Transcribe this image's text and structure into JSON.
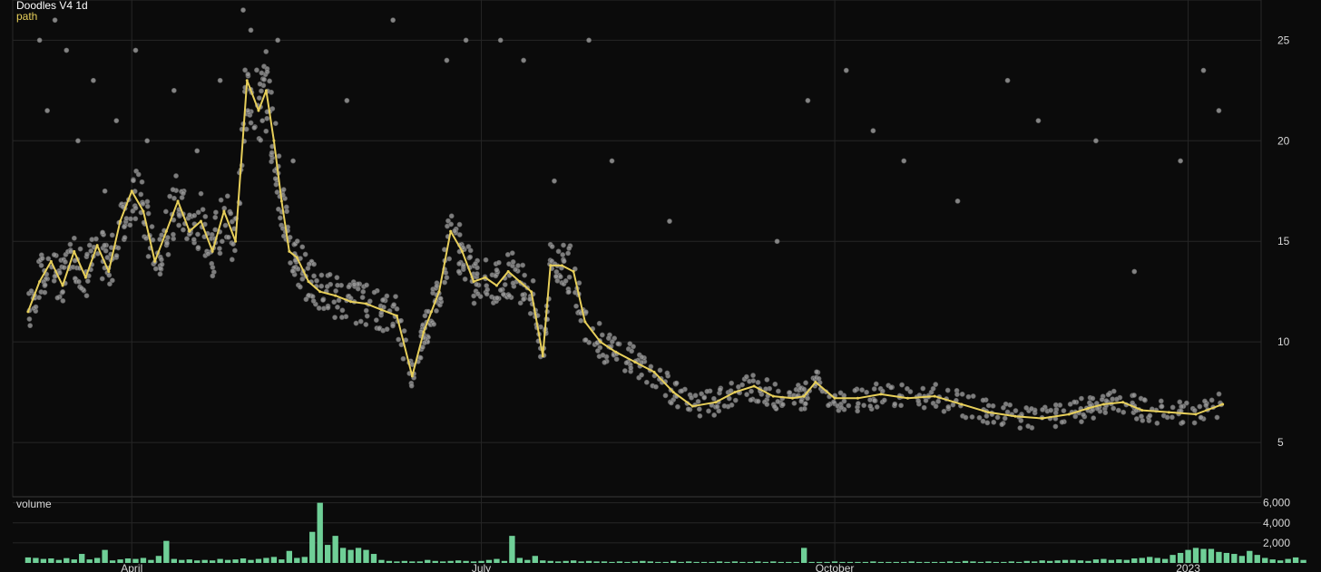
{
  "colors": {
    "background": "#0b0b0b",
    "grid": "#262626",
    "points": "#9a9a9a",
    "path": "#e7cf5a",
    "volume": "#6fcf97",
    "text": "#d8d8d8"
  },
  "chart_data": [
    {
      "type": "scatter",
      "title": "Doodles V4 1d",
      "xlabel": "",
      "ylabel": "",
      "x_type": "date",
      "xlim": [
        "2022-03-01",
        "2023-01-20"
      ],
      "ylim": [
        2.3,
        27.0
      ],
      "y_ticks": [
        5,
        10,
        15,
        20,
        25
      ],
      "x_ticks": [
        {
          "date": "2022-04-01",
          "label": "April"
        },
        {
          "date": "2022-07-01",
          "label": "July"
        },
        {
          "date": "2022-10-01",
          "label": "October"
        },
        {
          "date": "2023-01-01",
          "label": "2023"
        }
      ],
      "grid": true,
      "series": [
        {
          "name": "path",
          "type": "line",
          "x": [
            "2022-03-05",
            "2022-03-08",
            "2022-03-11",
            "2022-03-14",
            "2022-03-17",
            "2022-03-20",
            "2022-03-23",
            "2022-03-26",
            "2022-03-29",
            "2022-04-01",
            "2022-04-04",
            "2022-04-07",
            "2022-04-10",
            "2022-04-13",
            "2022-04-16",
            "2022-04-19",
            "2022-04-22",
            "2022-04-25",
            "2022-04-28",
            "2022-05-01",
            "2022-05-04",
            "2022-05-06",
            "2022-05-08",
            "2022-05-10",
            "2022-05-12",
            "2022-05-14",
            "2022-05-17",
            "2022-05-20",
            "2022-05-24",
            "2022-05-28",
            "2022-06-01",
            "2022-06-05",
            "2022-06-09",
            "2022-06-13",
            "2022-06-16",
            "2022-06-18",
            "2022-06-20",
            "2022-06-23",
            "2022-06-26",
            "2022-06-29",
            "2022-07-02",
            "2022-07-05",
            "2022-07-08",
            "2022-07-11",
            "2022-07-14",
            "2022-07-17",
            "2022-07-19",
            "2022-07-22",
            "2022-07-25",
            "2022-07-28",
            "2022-08-01",
            "2022-08-05",
            "2022-08-10",
            "2022-08-15",
            "2022-08-20",
            "2022-08-25",
            "2022-08-31",
            "2022-09-05",
            "2022-09-10",
            "2022-09-15",
            "2022-09-20",
            "2022-09-23",
            "2022-09-26",
            "2022-10-01",
            "2022-10-07",
            "2022-10-13",
            "2022-10-20",
            "2022-10-27",
            "2022-11-03",
            "2022-11-10",
            "2022-11-17",
            "2022-11-24",
            "2022-12-01",
            "2022-12-06",
            "2022-12-10",
            "2022-12-15",
            "2022-12-20",
            "2022-12-27",
            "2023-01-03",
            "2023-01-10"
          ],
          "y": [
            11.5,
            13.0,
            14.0,
            12.8,
            14.5,
            13.2,
            14.8,
            13.5,
            16.0,
            17.5,
            16.5,
            14.0,
            15.5,
            17.0,
            15.5,
            16.0,
            14.5,
            16.5,
            15.0,
            23.0,
            21.5,
            22.5,
            20.0,
            17.0,
            14.5,
            14.2,
            13.0,
            12.5,
            12.3,
            12.0,
            11.9,
            11.6,
            11.3,
            8.3,
            10.5,
            11.5,
            12.5,
            15.5,
            14.5,
            13.0,
            13.2,
            12.8,
            13.5,
            13.0,
            12.5,
            9.3,
            13.8,
            13.8,
            13.5,
            11.0,
            10.0,
            9.5,
            9.0,
            8.5,
            7.5,
            6.8,
            7.0,
            7.5,
            7.8,
            7.3,
            7.2,
            7.3,
            8.0,
            7.2,
            7.2,
            7.4,
            7.2,
            7.3,
            6.9,
            6.5,
            6.3,
            6.2,
            6.4,
            6.7,
            6.9,
            7.0,
            6.6,
            6.5,
            6.4,
            6.9
          ]
        },
        {
          "name": "",
          "type": "scatter",
          "note_points": "outlier trades shown as grey dots; dense clusters rendered along the path",
          "x": [
            "2022-03-08",
            "2022-03-10",
            "2022-03-12",
            "2022-03-15",
            "2022-03-18",
            "2022-03-22",
            "2022-03-25",
            "2022-03-28",
            "2022-04-02",
            "2022-04-05",
            "2022-04-12",
            "2022-04-18",
            "2022-04-24",
            "2022-04-30",
            "2022-05-02",
            "2022-05-05",
            "2022-05-09",
            "2022-05-13",
            "2022-05-27",
            "2022-06-08",
            "2022-06-17",
            "2022-06-22",
            "2022-06-27",
            "2022-07-06",
            "2022-07-12",
            "2022-07-20",
            "2022-07-29",
            "2022-08-04",
            "2022-08-19",
            "2022-09-16",
            "2022-09-24",
            "2022-10-04",
            "2022-10-11",
            "2022-10-19",
            "2022-11-02",
            "2022-11-15",
            "2022-11-23",
            "2022-12-08",
            "2022-12-18",
            "2022-12-30",
            "2023-01-05",
            "2023-01-09"
          ],
          "y": [
            25.0,
            21.5,
            26.0,
            24.5,
            20.0,
            23.0,
            17.5,
            21.0,
            24.5,
            20.0,
            22.5,
            19.5,
            23.0,
            26.5,
            25.5,
            21.0,
            25.0,
            19.0,
            22.0,
            26.0,
            10.0,
            24.0,
            25.0,
            25.0,
            24.0,
            18.0,
            25.0,
            19.0,
            16.0,
            15.0,
            22.0,
            23.5,
            20.5,
            19.0,
            17.0,
            23.0,
            21.0,
            20.0,
            13.5,
            19.0,
            23.5,
            21.5
          ]
        }
      ]
    },
    {
      "type": "bar",
      "title": "volume",
      "xlabel": "",
      "ylabel": "",
      "ylim": [
        0,
        6600
      ],
      "y_ticks": [
        2000,
        4000,
        6000
      ],
      "y_tick_labels": [
        "2,000",
        "4,000",
        "6,000"
      ],
      "x_start": "2022-03-05",
      "step_days": 2,
      "values": [
        550,
        500,
        400,
        450,
        300,
        480,
        350,
        900,
        350,
        500,
        1300,
        250,
        350,
        450,
        400,
        500,
        300,
        700,
        2200,
        400,
        300,
        350,
        250,
        300,
        250,
        400,
        300,
        350,
        450,
        300,
        400,
        500,
        600,
        350,
        1200,
        500,
        600,
        3100,
        6000,
        1800,
        2700,
        1500,
        1300,
        1500,
        1300,
        900,
        300,
        200,
        150,
        200,
        150,
        150,
        300,
        200,
        150,
        200,
        250,
        200,
        150,
        200,
        300,
        400,
        200,
        2700,
        500,
        300,
        700,
        250,
        200,
        150,
        200,
        250,
        150,
        200,
        150,
        150,
        100,
        150,
        100,
        150,
        200,
        150,
        100,
        100,
        200,
        100,
        150,
        100,
        100,
        100,
        150,
        100,
        150,
        100,
        100,
        150,
        100,
        150,
        100,
        100,
        100,
        1500,
        100,
        100,
        100,
        150,
        100,
        100,
        100,
        100,
        150,
        100,
        100,
        100,
        100,
        150,
        100,
        100,
        100,
        100,
        150,
        100,
        200,
        150,
        100,
        150,
        100,
        100,
        150,
        100,
        200,
        150,
        250,
        200,
        250,
        300,
        300,
        250,
        200,
        350,
        400,
        300,
        350,
        300,
        450,
        500,
        600,
        500,
        400,
        800,
        1000,
        1300,
        1500,
        1400,
        1400,
        1100,
        1000,
        900,
        700,
        1200,
        800,
        500,
        350,
        250,
        400,
        550,
        300
      ]
    }
  ]
}
